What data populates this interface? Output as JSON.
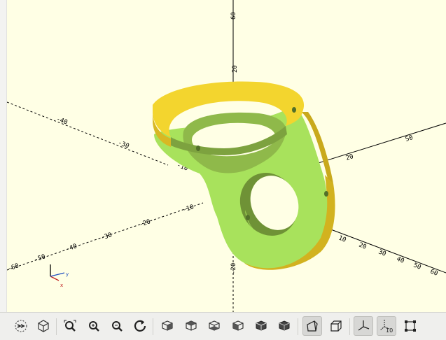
{
  "app": "OpenSCAD",
  "viewport": {
    "background": "#ffffe5",
    "model_top_color": "#f6d530",
    "model_side_color": "#cdb020",
    "model_face_color": "#a9e35e",
    "model_shadow_color": "#7d9e40",
    "axis_labels": {
      "y_pos_50": "50",
      "y_pos_20": "20",
      "x_pos_50": "50",
      "x_pos_20": "20",
      "z_pos_60": "60",
      "z_pos_20": "20",
      "x_neg_30": "-30",
      "x_neg_40": "-40",
      "x_neg_10": "-10",
      "y_neg_10": "-10",
      "y_neg_20": "-20",
      "y_neg_30": "-30",
      "y_neg_40": "-40",
      "y_neg_50": "-50",
      "y_neg_60": "-60",
      "z_neg_20": "-20",
      "r_10": "10",
      "r_20": "20",
      "r_30": "30",
      "r_40": "40",
      "r_50": "50",
      "r_60": "60"
    }
  },
  "toolbar": {
    "scale_marker_label": "10",
    "buttons": [
      {
        "name": "render-button",
        "icon": "render-icon"
      },
      {
        "name": "export-stl-button",
        "icon": "export-icon"
      },
      {
        "name": "view-all-button",
        "icon": "view-all-icon"
      },
      {
        "name": "zoom-in-button",
        "icon": "zoom-in-icon"
      },
      {
        "name": "zoom-out-button",
        "icon": "zoom-out-icon"
      },
      {
        "name": "reset-view-button",
        "icon": "reset-view-icon"
      },
      {
        "name": "view-right-button",
        "icon": "view-right-icon"
      },
      {
        "name": "view-top-button",
        "icon": "view-top-icon"
      },
      {
        "name": "view-bottom-button",
        "icon": "view-bottom-icon"
      },
      {
        "name": "view-left-button",
        "icon": "view-left-icon"
      },
      {
        "name": "view-front-button",
        "icon": "view-front-icon"
      },
      {
        "name": "view-back-button",
        "icon": "view-back-icon"
      },
      {
        "name": "perspective-button",
        "icon": "perspective-icon",
        "active": true
      },
      {
        "name": "orthogonal-button",
        "icon": "orthogonal-icon"
      },
      {
        "name": "show-axes-button",
        "icon": "axes-icon",
        "active": true
      },
      {
        "name": "show-scale-markers-button",
        "icon": "scale-markers-icon",
        "active": true
      },
      {
        "name": "show-edges-button",
        "icon": "edges-icon"
      }
    ]
  }
}
